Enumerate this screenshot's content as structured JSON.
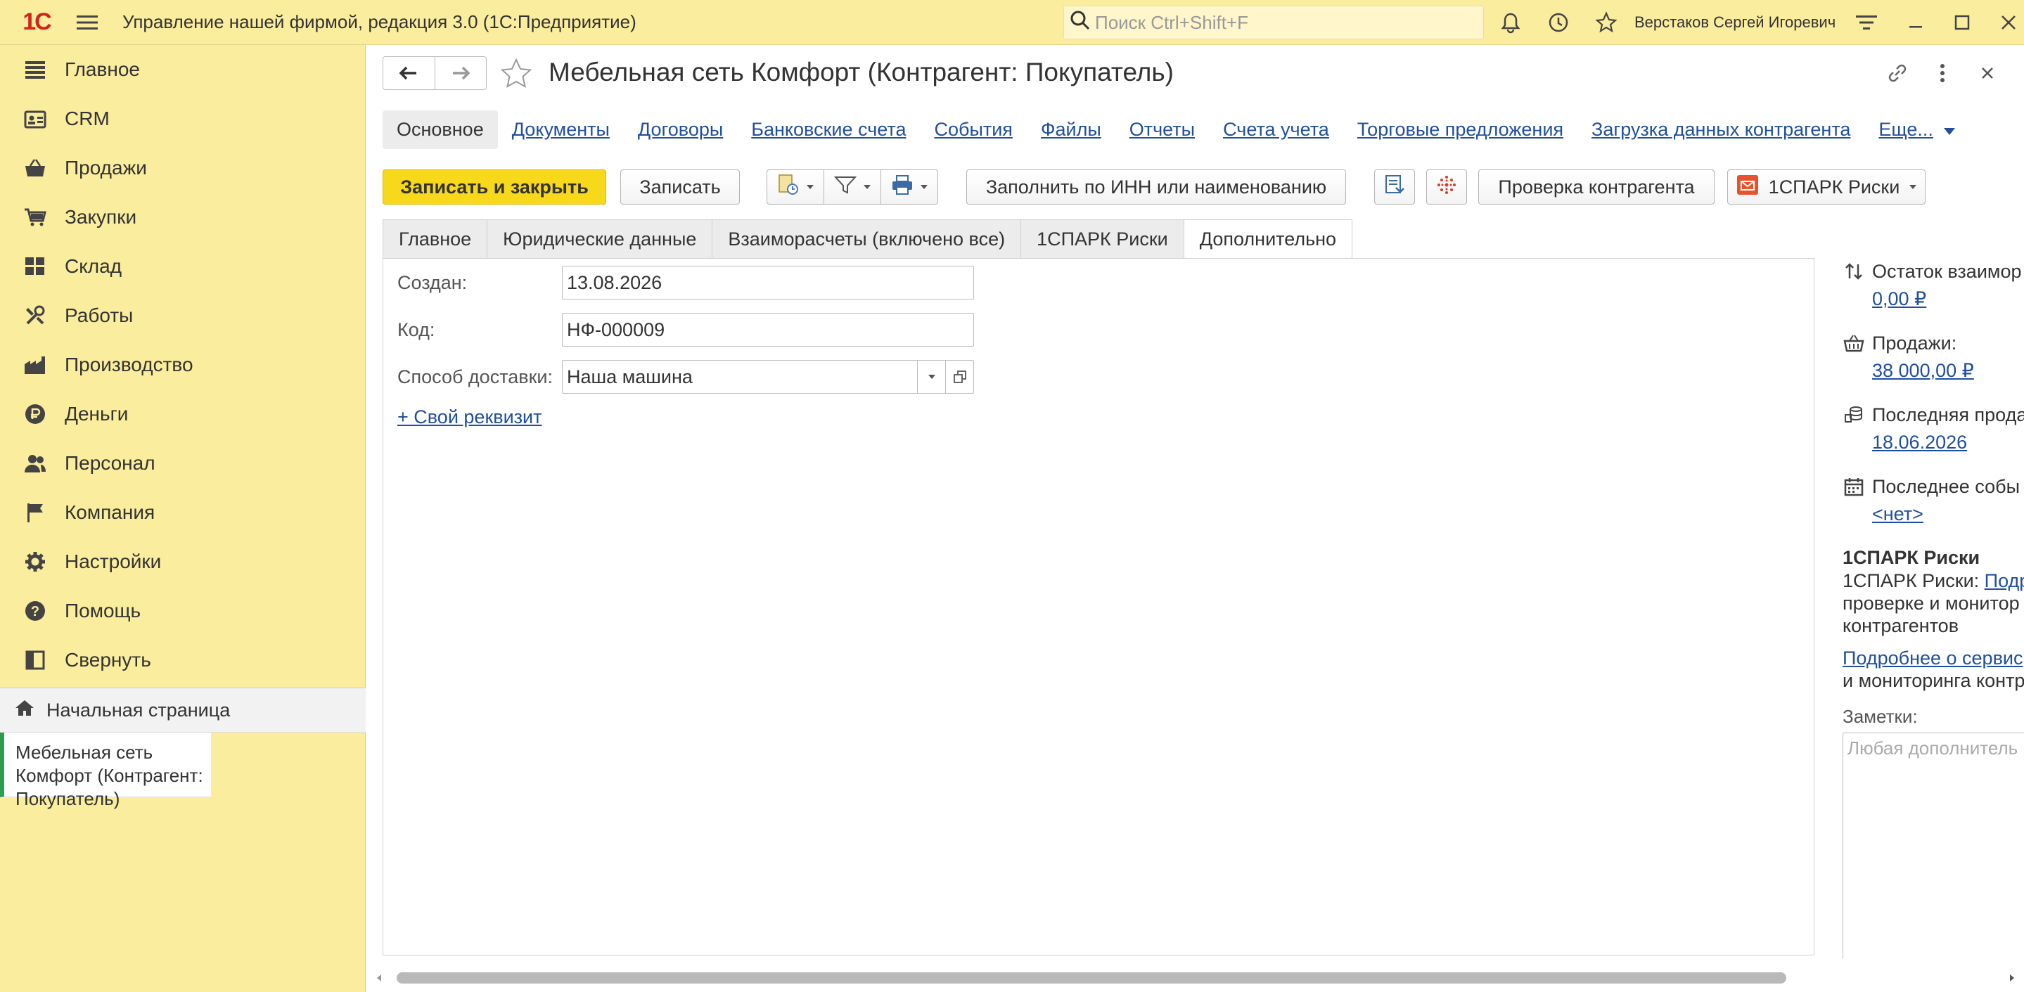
{
  "app": {
    "title": "Управление нашей фирмой, редакция 3.0  (1С:Предприятие)",
    "search_placeholder": "Поиск Ctrl+Shift+F",
    "user_name": "Верстаков Сергей Игоревич"
  },
  "sidebar": {
    "items": [
      {
        "label": "Главное",
        "icon": "menu-lines-icon"
      },
      {
        "label": "CRM",
        "icon": "crm-card-icon"
      },
      {
        "label": "Продажи",
        "icon": "basket-icon"
      },
      {
        "label": "Закупки",
        "icon": "cart-icon"
      },
      {
        "label": "Склад",
        "icon": "warehouse-icon"
      },
      {
        "label": "Работы",
        "icon": "tools-icon"
      },
      {
        "label": "Производство",
        "icon": "factory-icon"
      },
      {
        "label": "Деньги",
        "icon": "ruble-icon"
      },
      {
        "label": "Персонал",
        "icon": "people-icon"
      },
      {
        "label": "Компания",
        "icon": "flag-icon"
      },
      {
        "label": "Настройки",
        "icon": "gear-icon"
      },
      {
        "label": "Помощь",
        "icon": "help-icon"
      },
      {
        "label": "Свернуть",
        "icon": "collapse-icon"
      }
    ],
    "home": "Начальная страница",
    "open_doc": "Мебельная сеть Комфорт (Контрагент: Покупатель)"
  },
  "doc": {
    "title": "Мебельная сеть Комфорт (Контрагент: Покупатель)",
    "links": [
      "Основное",
      "Документы",
      "Договоры",
      "Банковские счета",
      "События",
      "Файлы",
      "Отчеты",
      "Счета учета",
      "Торговые предложения",
      "Загрузка данных контрагента"
    ],
    "more_link": "Еще...",
    "toolbar": {
      "save_close": "Записать и закрыть",
      "save": "Записать",
      "fill_inn": "Заполнить по ИНН или наименованию",
      "check": "Проверка контрагента",
      "spark": "1СПАРК Риски"
    },
    "tabs": [
      "Главное",
      "Юридические данные",
      "Взаиморасчеты (включено все)",
      "1СПАРК Риски",
      "Дополнительно"
    ],
    "form": {
      "created_label": "Создан:",
      "created_value": "13.08.2026",
      "code_label": "Код:",
      "code_value": "НФ-000009",
      "delivery_label": "Способ доставки:",
      "delivery_value": "Наша машина",
      "custom_link": "+ Свой реквизит"
    }
  },
  "info": {
    "balance_title": "Остаток взаимор",
    "balance_value": "0,00 ₽",
    "sales_title": "Продажи:",
    "sales_value": "38 000,00 ₽",
    "last_sale_title": "Последняя прода",
    "last_sale_value": "18.06.2026",
    "last_event_title": "Последнее собы",
    "last_event_value": "<нет>",
    "spark_head": "1СПАРК Риски",
    "spark_line1_prefix": "1СПАРК Риски: ",
    "spark_line1_link": "Подр",
    "spark_line2": "проверке и монитор",
    "spark_line3": "контрагентов",
    "spark_more_link": "Подробнее о сервис",
    "spark_more_line2": "и мониторинга контр",
    "notes_label": "Заметки:",
    "notes_placeholder": "Любая дополнитель"
  },
  "colors": {
    "accent_yellow": "#fbed9e",
    "primary_button": "#f8d81a",
    "link": "#1f4f9e",
    "logo_red": "#d0241c",
    "active_doc_bar": "#2e9c4f"
  }
}
